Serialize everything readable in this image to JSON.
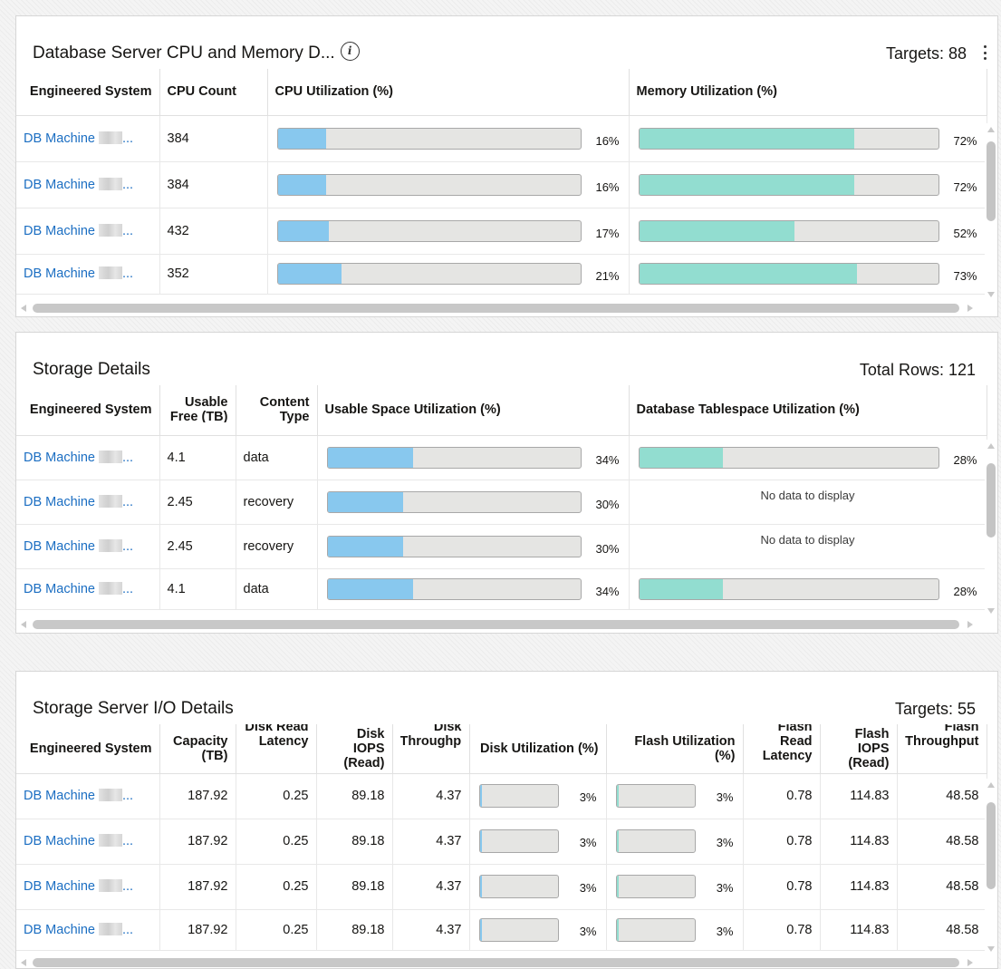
{
  "colors": {
    "cpu_bar": "#88c8ee",
    "memory_bar": "#92ddd0",
    "link": "#1b6ec2"
  },
  "cpu_panel": {
    "title": "Database Server CPU and Memory D...",
    "info_icon": "info-icon",
    "count_label": "Targets: 88",
    "menu_icon": "kebab-icon",
    "columns": [
      "Engineered System",
      "CPU Count",
      "CPU Utilization (%)",
      "Memory Utilization (%)"
    ],
    "rows": [
      {
        "system": "DB Machine",
        "suffix": "...",
        "cpu_count": "384",
        "cpu_pct": 16,
        "cpu_label": "16%",
        "mem_pct": 72,
        "mem_label": "72%"
      },
      {
        "system": "DB Machine",
        "suffix": "...",
        "cpu_count": "384",
        "cpu_pct": 16,
        "cpu_label": "16%",
        "mem_pct": 72,
        "mem_label": "72%"
      },
      {
        "system": "DB Machine",
        "suffix": "...",
        "cpu_count": "432",
        "cpu_pct": 17,
        "cpu_label": "17%",
        "mem_pct": 52,
        "mem_label": "52%"
      },
      {
        "system": "DB Machine",
        "suffix": "...",
        "cpu_count": "352",
        "cpu_pct": 21,
        "cpu_label": "21%",
        "mem_pct": 73,
        "mem_label": "73%"
      }
    ]
  },
  "storage_panel": {
    "title": "Storage Details",
    "count_label": "Total Rows: 121",
    "columns": [
      "Engineered System",
      "Usable Free (TB)",
      "Content Type",
      "Usable Space Utilization (%)",
      "Database Tablespace Utilization (%)"
    ],
    "no_data_text": "No data to display",
    "rows": [
      {
        "system": "DB Machine",
        "suffix": "...",
        "free": "4.1",
        "type": "data",
        "usable_pct": 34,
        "usable_label": "34%",
        "db_pct": 28,
        "db_label": "28%"
      },
      {
        "system": "DB Machine",
        "suffix": "...",
        "free": "2.45",
        "type": "recovery",
        "usable_pct": 30,
        "usable_label": "30%",
        "db_pct": null,
        "db_label": null
      },
      {
        "system": "DB Machine",
        "suffix": "...",
        "free": "2.45",
        "type": "recovery",
        "usable_pct": 30,
        "usable_label": "30%",
        "db_pct": null,
        "db_label": null
      },
      {
        "system": "DB Machine",
        "suffix": "...",
        "free": "4.1",
        "type": "data",
        "usable_pct": 34,
        "usable_label": "34%",
        "db_pct": 28,
        "db_label": "28%"
      }
    ]
  },
  "io_panel": {
    "title": "Storage Server I/O Details",
    "count_label": "Targets: 55",
    "columns": [
      "Engineered System",
      "Capacity (TB)",
      "Disk Read Latency",
      "Disk IOPS (Read)",
      "Disk Throughput",
      "Disk Utilization (%)",
      "Flash Utilization (%)",
      "Flash Read Latency",
      "Flash IOPS (Read)",
      "Flash Throughput"
    ],
    "rows": [
      {
        "system": "DB Machine",
        "suffix": "...",
        "capacity": "187.92",
        "disk_lat": "0.25",
        "disk_iops": "89.18",
        "disk_thr": "4.37",
        "disk_pct": 3,
        "disk_label": "3%",
        "flash_pct": 3,
        "flash_label": "3%",
        "flash_lat": "0.78",
        "flash_iops": "114.83",
        "flash_thr": "48.58"
      },
      {
        "system": "DB Machine",
        "suffix": "...",
        "capacity": "187.92",
        "disk_lat": "0.25",
        "disk_iops": "89.18",
        "disk_thr": "4.37",
        "disk_pct": 3,
        "disk_label": "3%",
        "flash_pct": 3,
        "flash_label": "3%",
        "flash_lat": "0.78",
        "flash_iops": "114.83",
        "flash_thr": "48.58"
      },
      {
        "system": "DB Machine",
        "suffix": "...",
        "capacity": "187.92",
        "disk_lat": "0.25",
        "disk_iops": "89.18",
        "disk_thr": "4.37",
        "disk_pct": 3,
        "disk_label": "3%",
        "flash_pct": 3,
        "flash_label": "3%",
        "flash_lat": "0.78",
        "flash_iops": "114.83",
        "flash_thr": "48.58"
      },
      {
        "system": "DB Machine",
        "suffix": "...",
        "capacity": "187.92",
        "disk_lat": "0.25",
        "disk_iops": "89.18",
        "disk_thr": "4.37",
        "disk_pct": 3,
        "disk_label": "3%",
        "flash_pct": 3,
        "flash_label": "3%",
        "flash_lat": "0.78",
        "flash_iops": "114.83",
        "flash_thr": "48.58"
      }
    ]
  }
}
